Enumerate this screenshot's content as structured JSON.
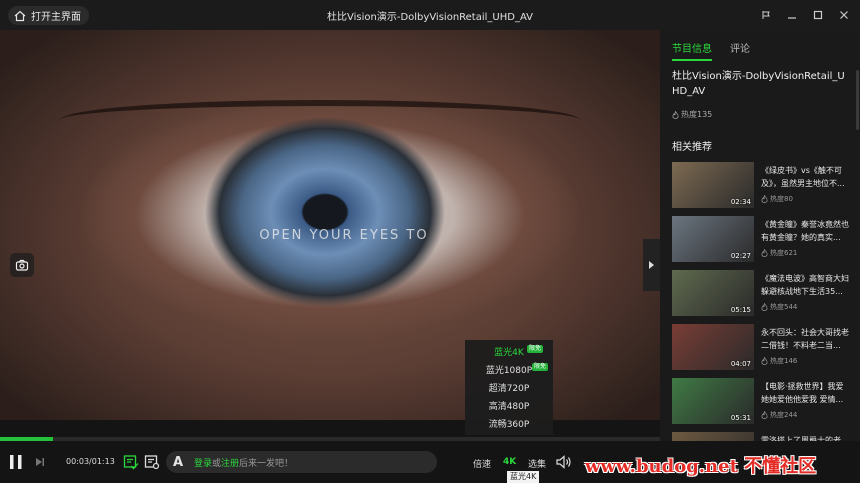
{
  "titlebar": {
    "home_label": "打开主界面",
    "title": "杜比Vision演示-DolbyVisionRetail_UHD_AV"
  },
  "video": {
    "overlay_text": "OPEN YOUR EYES TO",
    "progress": 0.08
  },
  "quality_menu": {
    "items": [
      {
        "label": "蓝光4K",
        "badge": "限免",
        "active": true
      },
      {
        "label": "蓝光1080P",
        "badge": "限免",
        "active": false
      },
      {
        "label": "超清720P",
        "badge": "",
        "active": false
      },
      {
        "label": "高清480P",
        "badge": "",
        "active": false
      },
      {
        "label": "流畅360P",
        "badge": "",
        "active": false
      }
    ]
  },
  "controls": {
    "time": "00:03/01:13",
    "danmaku_letter": "A",
    "danmaku_login": "登录",
    "danmaku_or": "或",
    "danmaku_register": "注册",
    "danmaku_rest": "后来一发吧！",
    "speed_label": "倍速",
    "quality_label": "4K",
    "episodes_label": "选集",
    "tooltip": "蓝光4K"
  },
  "sidebar": {
    "tabs": [
      "节目信息",
      "评论"
    ],
    "show_title": "杜比Vision演示-DolbyVisionRetail_UHD_AV",
    "show_heat": "热度135",
    "section_title": "相关推荐",
    "recommendations": [
      {
        "title": "《绿皮书》vs《触不可及》，虽然男主地位不...",
        "heat": "热度80",
        "duration": "02:34",
        "color": "#7d6a52"
      },
      {
        "title": "《黄金瞳》秦誉冰竟然也有黄金瞳？她的真实...",
        "heat": "热度621",
        "duration": "02:27",
        "color": "#6b7580"
      },
      {
        "title": "《魔法电波》高智商大妇躲避核战地下生活35...",
        "heat": "热度544",
        "duration": "05:15",
        "color": "#5f6a4e"
      },
      {
        "title": "永不回头：社会大哥找老二借钱！不料老二当...",
        "heat": "热度146",
        "duration": "04:07",
        "color": "#7a3d35"
      },
      {
        "title": "【电影·拯救世界】我爱她她爱他他爱我 爱情...",
        "heat": "热度244",
        "duration": "05:31",
        "color": "#3f7a45"
      },
      {
        "title": "雷洛搭上了周爵士的老...",
        "heat": "",
        "duration": "",
        "color": "#6e5a40"
      }
    ]
  },
  "watermark": "www.budog.net 不懂社区",
  "colors": {
    "accent": "#2bd83c",
    "background": "#141414",
    "sidebar": "#1a1a1a"
  }
}
